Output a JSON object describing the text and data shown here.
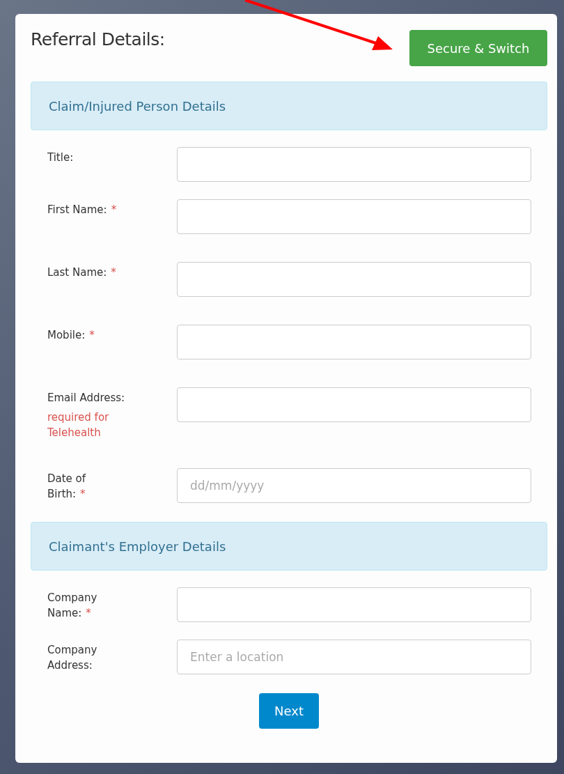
{
  "header": {
    "title": "Referral Details:",
    "action_button": "Secure & Switch"
  },
  "sections": [
    {
      "title": "Claim/Injured Person Details",
      "fields": [
        {
          "label_lines": [
            "Title:"
          ]
        },
        {
          "label_lines": [
            "First Name:"
          ],
          "required_mark": "*"
        },
        {
          "label_lines": [
            "Last Name:"
          ],
          "required_mark": "*"
        },
        {
          "label_lines": [
            "Mobile:"
          ],
          "required_mark": "*"
        },
        {
          "label_lines": [
            "Email Address:"
          ],
          "note": "required for Telehealth"
        },
        {
          "label_lines": [
            "Date of",
            "Birth:"
          ],
          "required_mark": "*",
          "placeholder": "dd/mm/yyyy"
        }
      ]
    },
    {
      "title": "Claimant's Employer Details",
      "fields": [
        {
          "label_lines": [
            "Company",
            "Name:"
          ],
          "required_mark": "*"
        },
        {
          "label_lines": [
            "Company",
            "Address:"
          ],
          "placeholder": "Enter a location"
        }
      ]
    }
  ],
  "next_button": "Next"
}
